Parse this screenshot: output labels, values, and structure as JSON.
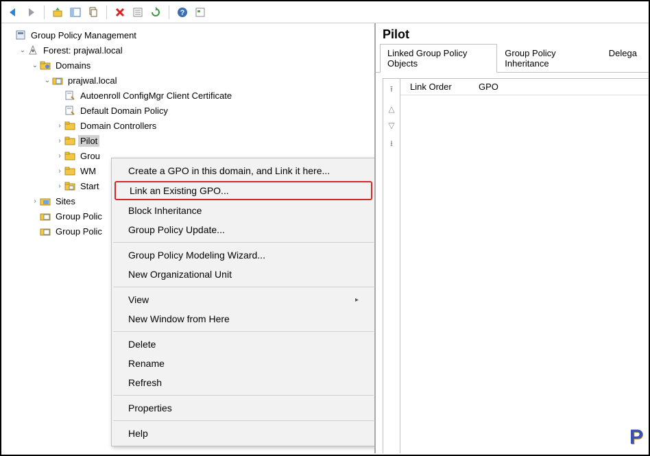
{
  "toolbar": {
    "back": "Back",
    "forward": "Forward",
    "up": "Up",
    "show_hide": "Show/Hide",
    "copy": "Copy",
    "delete": "Delete",
    "properties": "Properties",
    "refresh": "Refresh",
    "help": "Help",
    "options": "Options"
  },
  "tree": {
    "root": "Group Policy Management",
    "forest": "Forest: prajwal.local",
    "domains": "Domains",
    "domain": "prajwal.local",
    "gpo1": "Autoenroll ConfigMgr Client Certificate",
    "gpo2": "Default Domain Policy",
    "ou1": "Domain Controllers",
    "ou2": "Pilot",
    "ou3_truncated": "Grou",
    "ou4_truncated": "WM",
    "starter_truncated": "Start",
    "sites": "Sites",
    "modeling_truncated": "Group Polic",
    "results_truncated": "Group Polic"
  },
  "context_menu": {
    "create_link": "Create a GPO in this domain, and Link it here...",
    "link_existing": "Link an Existing GPO...",
    "block_inherit": "Block Inheritance",
    "gp_update": "Group Policy Update...",
    "modeling_wizard": "Group Policy Modeling Wizard...",
    "new_ou": "New Organizational Unit",
    "view": "View",
    "new_window": "New Window from Here",
    "delete": "Delete",
    "rename": "Rename",
    "refresh": "Refresh",
    "properties": "Properties",
    "help": "Help"
  },
  "detail": {
    "title": "Pilot",
    "tab1": "Linked Group Policy Objects",
    "tab2": "Group Policy Inheritance",
    "tab3": "Delega",
    "col1": "Link Order",
    "col2": "GPO"
  },
  "logo": "P"
}
